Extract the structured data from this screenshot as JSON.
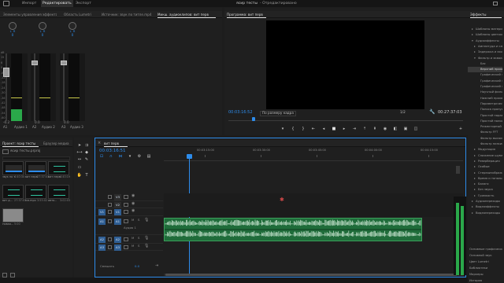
{
  "top_menu": {
    "items": [
      "Импорт",
      "Редактировать",
      "Экспорт"
    ],
    "active_index": 1,
    "project_title": "ясир тесты",
    "project_status": "- Отредактировано",
    "right_icons": [
      "home-icon",
      "fullscreen-icon"
    ]
  },
  "mixer_panel": {
    "tabs": [
      "Элементы управления эффектами",
      "Область Lumetri",
      "Источник: звук по титле.mp4",
      "Микш. аудиоклипов: вит перв"
    ],
    "active_tab": 3,
    "channels": [
      {
        "pan_value": "0",
        "label": "A1",
        "name": "Аудио 1",
        "level_value": "-0.2",
        "meter_fill": 0.17
      },
      {
        "pan_value": "0",
        "label": "A2",
        "name": "Аудио 2",
        "level_value": "0.0",
        "meter_fill": 0
      },
      {
        "pan_value": "0",
        "label": "A3",
        "name": "Аудио 3",
        "level_value": "0.0",
        "meter_fill": 0
      }
    ],
    "db_scale": [
      "dB",
      "15",
      "6",
      "0",
      "-6",
      "-12",
      "-18",
      "-24",
      "-30",
      "-36",
      "-42",
      "-48",
      "-54",
      "-60"
    ]
  },
  "program_monitor": {
    "title": "Программа: вит перв",
    "timecode": "00:03:16:52",
    "fit_label": "По размеру кадра",
    "quality_label": "1/2",
    "duration": "00:27:37:03",
    "playhead_fraction": 0.1
  },
  "effects_panel": {
    "title": "Эффекты",
    "items": [
      {
        "label": "Шаблоны материала",
        "indent": 1,
        "expanded": false,
        "selected": false
      },
      {
        "label": "Шаблоны цветоко.",
        "indent": 1,
        "expanded": false,
        "selected": false
      },
      {
        "label": "Аудиоэффекты",
        "indent": 1,
        "expanded": true,
        "selected": false
      },
      {
        "label": "Амплитуда и сжатие",
        "indent": 2,
        "expanded": false,
        "selected": false
      },
      {
        "label": "Задержка и эхо",
        "indent": 2,
        "expanded": false,
        "selected": false
      },
      {
        "label": "Фильтр и эквалайзер",
        "indent": 2,
        "expanded": true,
        "selected": false
      },
      {
        "label": "Бас",
        "indent": 3,
        "expanded": false,
        "selected": false
      },
      {
        "label": "Верхний проход",
        "indent": 3,
        "expanded": false,
        "selected": true
      },
      {
        "label": "Графический эквалайзер",
        "indent": 3,
        "expanded": false,
        "selected": false
      },
      {
        "label": "Графический эквалайзер",
        "indent": 3,
        "expanded": false,
        "selected": false
      },
      {
        "label": "Графический эквалайзер",
        "indent": 3,
        "expanded": false,
        "selected": false
      },
      {
        "label": "Научный фильтр",
        "indent": 3,
        "expanded": false,
        "selected": false
      },
      {
        "label": "Нижний проход",
        "indent": 3,
        "expanded": false,
        "selected": false
      },
      {
        "label": "Параметрический",
        "indent": 3,
        "expanded": false,
        "selected": false
      },
      {
        "label": "Полоса пропускания",
        "indent": 3,
        "expanded": false,
        "selected": false
      },
      {
        "label": "Простой параметрический",
        "indent": 3,
        "expanded": false,
        "selected": false
      },
      {
        "label": "Простой полосовой",
        "indent": 3,
        "expanded": false,
        "selected": false
      },
      {
        "label": "Режекторный фильтр",
        "indent": 3,
        "expanded": false,
        "selected": false
      },
      {
        "label": "Фильтр FFT",
        "indent": 3,
        "expanded": false,
        "selected": false
      },
      {
        "label": "Фильтр высоких частот",
        "indent": 3,
        "expanded": false,
        "selected": false
      },
      {
        "label": "Фильтр низких частот",
        "indent": 3,
        "expanded": false,
        "selected": false
      },
      {
        "label": "Модуляция",
        "indent": 2,
        "expanded": false,
        "selected": false
      },
      {
        "label": "Снижение шума",
        "indent": 2,
        "expanded": false,
        "selected": false
      },
      {
        "label": "Реверберация",
        "indent": 2,
        "expanded": false,
        "selected": false
      },
      {
        "label": "Особые",
        "indent": 2,
        "expanded": false,
        "selected": false
      },
      {
        "label": "Стереоизображение",
        "indent": 2,
        "expanded": false,
        "selected": false
      },
      {
        "label": "Время и тональность",
        "indent": 2,
        "expanded": false,
        "selected": false
      },
      {
        "label": "Баланс",
        "indent": 2,
        "expanded": false,
        "selected": false
      },
      {
        "label": "Без звука",
        "indent": 2,
        "expanded": false,
        "selected": false
      },
      {
        "label": "Громкость",
        "indent": 2,
        "expanded": false,
        "selected": false
      },
      {
        "label": "Аудиопереходы",
        "indent": 1,
        "expanded": false,
        "selected": false
      },
      {
        "label": "Видеоэффекты",
        "indent": 1,
        "expanded": false,
        "selected": false
      },
      {
        "label": "Видеопереходы",
        "indent": 1,
        "expanded": false,
        "selected": false
      }
    ],
    "bottom_links": [
      "Основные графические",
      "Основной звук",
      "Цвет Lumetri",
      "Библиотеки",
      "Маркеры",
      "История",
      "Информация"
    ]
  },
  "project_panel": {
    "tabs": [
      "Проект: ясир тесты",
      "Браузер медиа"
    ],
    "project_file": "ясир тесты.prproj",
    "items": [
      {
        "name": "звук по т...",
        "dur": "4:40:30",
        "kind": "video"
      },
      {
        "name": "вит перв",
        "dur": "27:37:03",
        "kind": "video"
      },
      {
        "name": "вит перв...",
        "dur": "4:40:19",
        "kind": "audio"
      },
      {
        "name": "вит д...",
        "dur": "27:37:03",
        "kind": "audio"
      },
      {
        "name": "vid.mp4",
        "dur": "3:55:02",
        "kind": "audio"
      },
      {
        "name": "авто...",
        "dur": "3:02:03",
        "kind": "audio"
      },
      {
        "name": "Новая...",
        "dur": "5:00",
        "kind": "gray"
      }
    ]
  },
  "timeline": {
    "tab": "вит перв",
    "timecode": "00:03:16:51",
    "ruler_labels": [
      "00:03:15:00",
      "00:03:30:00",
      "00:03:45:00",
      "00:04:00:00",
      "00:04:15:00"
    ],
    "video_tracks": [
      {
        "label": "V3",
        "toggle": ""
      },
      {
        "label": "V2",
        "toggle": ""
      },
      {
        "label": "V1",
        "toggle": "V1"
      }
    ],
    "audio_tracks": [
      {
        "label": "A1",
        "toggle": "A1",
        "name": "Аудио 1"
      },
      {
        "label": "A2",
        "toggle": "A2",
        "name": ""
      },
      {
        "label": "A3",
        "toggle": "A3",
        "name": ""
      }
    ],
    "track_letters": [
      "M",
      "S"
    ],
    "master_label": "Смешать",
    "master_value": "0.0"
  },
  "colors": {
    "accent": "#2d8ceb",
    "audio_clip": "#1f6c3a",
    "meter_green": "#2aa84a"
  }
}
